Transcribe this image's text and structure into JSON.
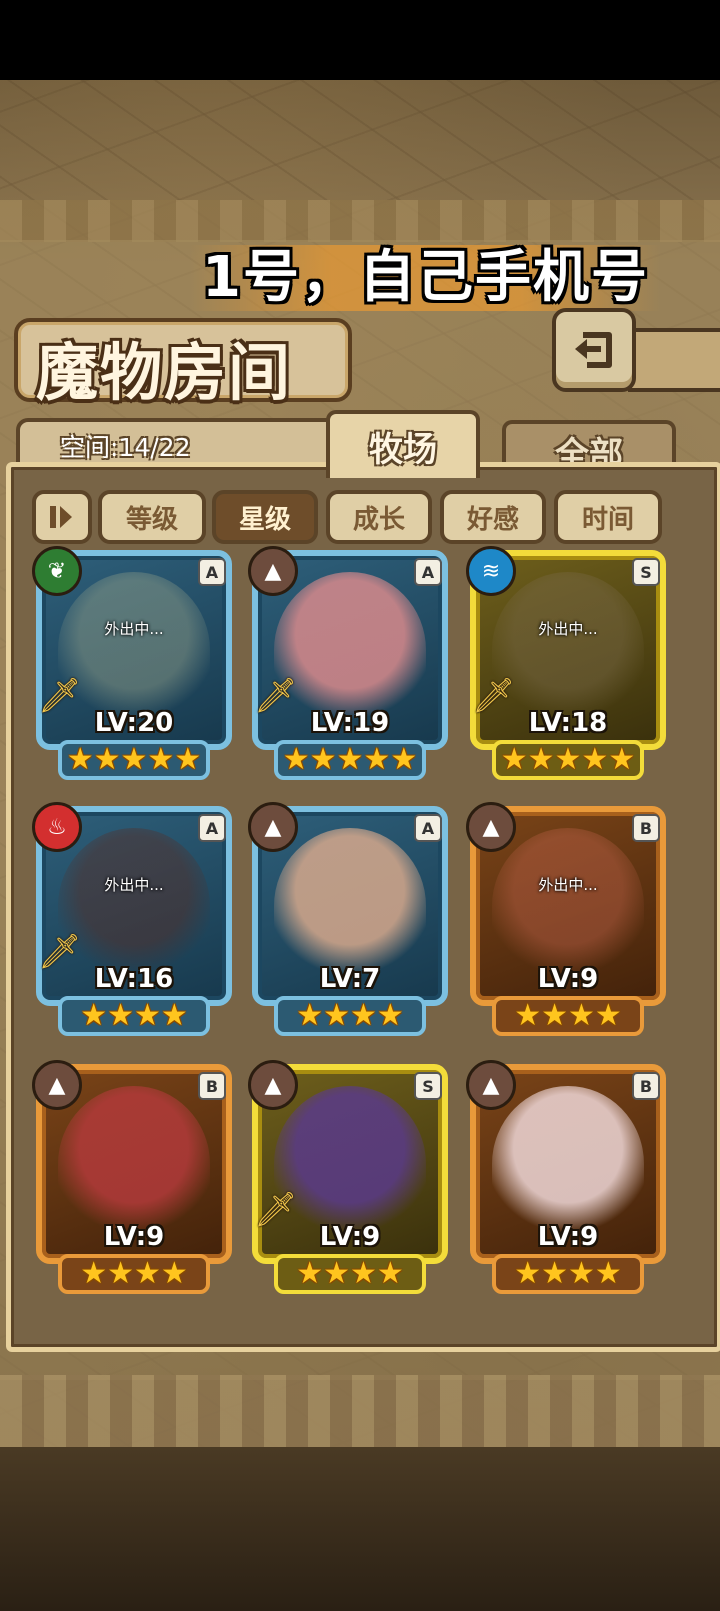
{
  "overlay_note": "1号，自己手机号",
  "header": {
    "title": "魔物房间",
    "back_icon": "back-arrow-icon"
  },
  "space": {
    "label": "空间:14/22"
  },
  "tabs": [
    {
      "label": "牧场",
      "active": true
    },
    {
      "label": "全部",
      "active": false
    }
  ],
  "filters": {
    "sort_icon": "sort-order-icon",
    "items": [
      {
        "label": "等级",
        "active": false
      },
      {
        "label": "星级",
        "active": true
      },
      {
        "label": "成长",
        "active": false
      },
      {
        "label": "好感",
        "active": false
      },
      {
        "label": "时间",
        "active": false
      }
    ]
  },
  "away_text": "外出中...",
  "monsters": [
    {
      "level": "LV:20",
      "rank": "A",
      "element": "leaf",
      "stars": 5,
      "away": true,
      "sword": true,
      "color": "#9aa58a"
    },
    {
      "level": "LV:19",
      "rank": "A",
      "element": "earth",
      "stars": 5,
      "away": false,
      "sword": true,
      "color": "#d98a8c"
    },
    {
      "level": "LV:18",
      "rank": "S",
      "element": "water",
      "stars": 5,
      "away": true,
      "sword": true,
      "color": "#7a6a4a"
    },
    {
      "level": "LV:16",
      "rank": "A",
      "element": "fire",
      "stars": 4,
      "away": true,
      "sword": true,
      "color": "#5a2a20"
    },
    {
      "level": "LV:7",
      "rank": "A",
      "element": "earth",
      "stars": 4,
      "away": false,
      "sword": false,
      "color": "#d7a98c"
    },
    {
      "level": "LV:9",
      "rank": "B",
      "element": "earth",
      "stars": 4,
      "away": true,
      "sword": false,
      "color": "#c0624a"
    },
    {
      "level": "LV:9",
      "rank": "B",
      "element": "earth",
      "stars": 4,
      "away": false,
      "sword": false,
      "color": "#b23a3a"
    },
    {
      "level": "LV:9",
      "rank": "S",
      "element": "earth",
      "stars": 4,
      "away": false,
      "sword": true,
      "color": "#5a3a8a"
    },
    {
      "level": "LV:9",
      "rank": "B",
      "element": "earth",
      "stars": 4,
      "away": false,
      "sword": false,
      "color": "#f0d8d8"
    }
  ],
  "element_colors": {
    "leaf": "#2e7d32",
    "earth": "#6d4c3d",
    "water": "#1e88c8",
    "fire": "#d32f2f"
  },
  "element_glyphs": {
    "leaf": "❦",
    "earth": "▲",
    "water": "≋",
    "fire": "♨"
  }
}
